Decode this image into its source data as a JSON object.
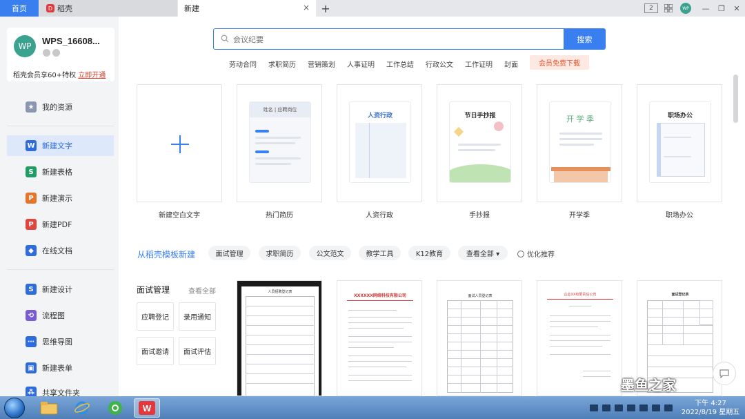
{
  "tabs": {
    "home": "首页",
    "daoke": "稻壳",
    "new": "新建",
    "new_close": "×",
    "add": "+"
  },
  "window": {
    "avatar_small": "WP",
    "layout_icon": "2",
    "minimize": "—",
    "restore": "❐",
    "close": "✕"
  },
  "user": {
    "avatar_text": "WP",
    "name": "WPS_16608...",
    "member_text": "稻壳会员享60+特权 ",
    "member_link": "立即开通"
  },
  "sidebar": {
    "items": [
      {
        "label": "我的资源",
        "icon": "star-icon",
        "color": "#8a97b1",
        "glyph": "★"
      },
      {
        "label": "新建文字",
        "icon": "writer-icon",
        "color": "#2d6bde",
        "glyph": "W"
      },
      {
        "label": "新建表格",
        "icon": "spreadsheet-icon",
        "color": "#1f9d63",
        "glyph": "S"
      },
      {
        "label": "新建演示",
        "icon": "presentation-icon",
        "color": "#e8742a",
        "glyph": "P"
      },
      {
        "label": "新建PDF",
        "icon": "pdf-icon",
        "color": "#e2433b",
        "glyph": "P"
      },
      {
        "label": "在线文档",
        "icon": "online-doc-icon",
        "color": "#2d6bde",
        "glyph": "◆"
      },
      {
        "label": "新建设计",
        "icon": "design-icon",
        "color": "#2d6bde",
        "glyph": "S"
      },
      {
        "label": "流程图",
        "icon": "flowchart-icon",
        "color": "#7b5ad6",
        "glyph": "⟲"
      },
      {
        "label": "思维导图",
        "icon": "mindmap-icon",
        "color": "#2d6bde",
        "glyph": "⋯"
      },
      {
        "label": "新建表单",
        "icon": "form-icon",
        "color": "#2d6bde",
        "glyph": "▣"
      },
      {
        "label": "共享文件夹",
        "icon": "shared-folder-icon",
        "color": "#2d6bde",
        "glyph": "⁂"
      }
    ]
  },
  "search": {
    "placeholder": "会议纪要",
    "button": "搜索"
  },
  "hot_tags": [
    "劳动合同",
    "求职简历",
    "营销策划",
    "人事证明",
    "工作总结",
    "行政公文",
    "工作证明",
    "封面"
  ],
  "vip_tag": "会员免费下载",
  "templates": {
    "blank": "新建空白文字",
    "cards": [
      {
        "label": "热门简历",
        "thumb_title": "姓名 | 应聘岗位"
      },
      {
        "label": "人资行政",
        "thumb_title": "人资行政"
      },
      {
        "label": "手抄报",
        "thumb_title": "节日手抄报"
      },
      {
        "label": "开学季",
        "thumb_title": "开 学 季"
      },
      {
        "label": "职场办公",
        "thumb_title": "职场办公"
      }
    ]
  },
  "category": {
    "title": "从稻壳模板新建",
    "pills": [
      "面试管理",
      "求职简历",
      "公文范文",
      "教学工具",
      "K12教育",
      "查看全部 ▾"
    ],
    "optimize": "优化推荐"
  },
  "interview": {
    "title": "面试管理",
    "more": "查看全部",
    "buttons": [
      "应聘登记",
      "录用通知",
      "面试邀请",
      "面试评估"
    ]
  },
  "docs": {
    "titles": [
      "人员招聘登记表",
      "XXXXXX网络科技有限公司",
      "面试人员登记表",
      "企业XX有限责任公司",
      "面试登记表"
    ]
  },
  "watermark": "墨鱼之家",
  "clock": {
    "time": "下午 4:27",
    "date": "2022/8/19 星期五"
  }
}
